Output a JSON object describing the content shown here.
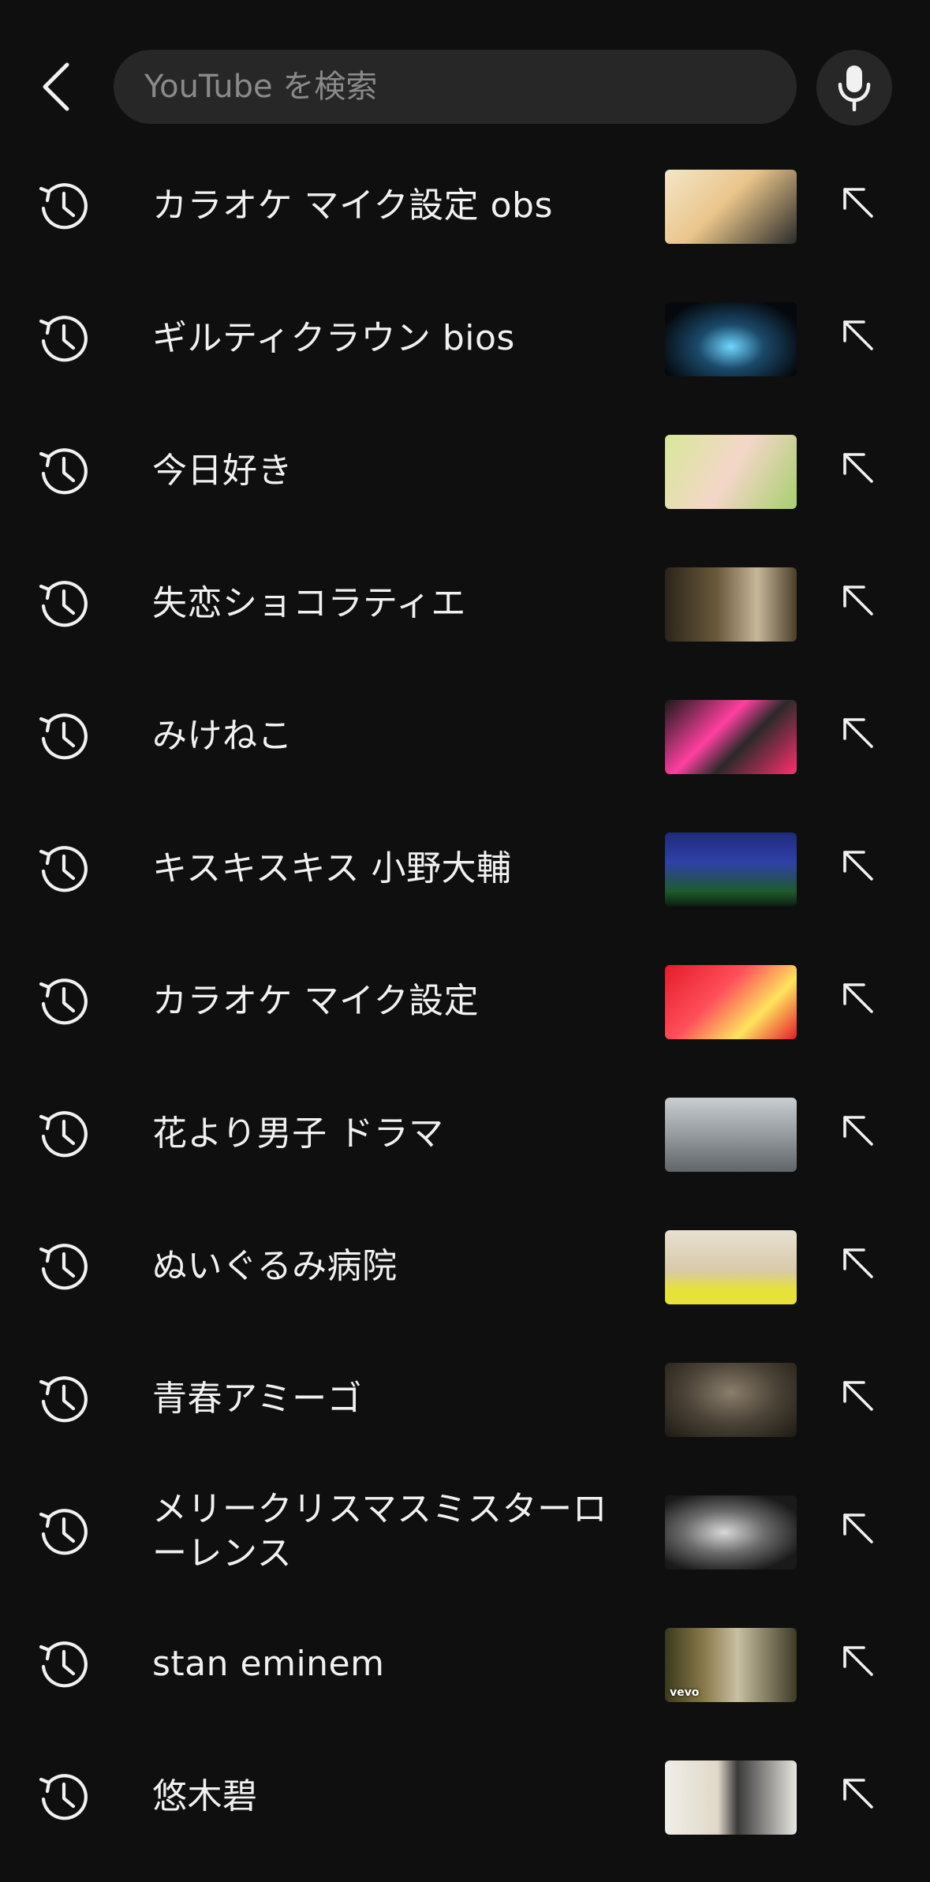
{
  "search": {
    "placeholder": "YouTube を検索"
  },
  "icons": {
    "back": "chevron-left-icon",
    "mic": "microphone-icon",
    "history": "history-clock-icon",
    "fill": "arrow-up-left-icon"
  },
  "colors": {
    "background": "#0f0f0f",
    "searchBox": "#272727",
    "text": "#f1f1f1",
    "placeholder": "#8a8a8a"
  },
  "history": [
    {
      "query": "カラオケ マイク設定 obs",
      "thumb": {
        "bg": "linear-gradient(135deg,#f4e6c8 0%,#e9c58a 45%,#2b2b2b 100%)",
        "overlay": ""
      }
    },
    {
      "query": "ギルティクラウン bios",
      "thumb": {
        "bg": "radial-gradient(ellipse at 50% 60%,#6fd6ff 0%,#1b4a6b 35%,#05080d 80%)",
        "overlay": ""
      }
    },
    {
      "query": "今日好き",
      "thumb": {
        "bg": "linear-gradient(120deg,#d7e89a 0%,#f4d6c8 50%,#a7cf6e 100%)",
        "overlay": ""
      }
    },
    {
      "query": "失恋ショコラティエ",
      "thumb": {
        "bg": "linear-gradient(90deg,#2b2418 0%,#6b5a3c 40%,#c7b79a 70%,#4a3e2a 100%)",
        "overlay": ""
      }
    },
    {
      "query": "みけねこ",
      "thumb": {
        "bg": "linear-gradient(135deg,#1a1a1a 0%,#ff3fa0 40%,#2a2a2a 60%,#ff2f6f 100%)",
        "overlay": ""
      }
    },
    {
      "query": "キスキスキス 小野大輔",
      "thumb": {
        "bg": "linear-gradient(180deg,#1e2b7a 0%,#3040a8 40%,#1d5a2c 80%,#0c1a10 100%)",
        "overlay": ""
      }
    },
    {
      "query": "カラオケ マイク設定",
      "thumb": {
        "bg": "linear-gradient(135deg,#e51b2b 0%,#ff4f5a 40%,#ffe45c 70%,#e51b2b 100%)",
        "overlay": ""
      }
    },
    {
      "query": "花より男子 ドラマ",
      "thumb": {
        "bg": "linear-gradient(180deg,#c9cdd0 0%,#9aa0a4 45%,#5f6568 100%)",
        "overlay": ""
      }
    },
    {
      "query": "ぬいぐるみ病院",
      "thumb": {
        "bg": "linear-gradient(180deg,#e8e0d2 0%,#d8c9a8 55%,#e7e23a 80%,#e7e23a 100%)",
        "overlay": ""
      }
    },
    {
      "query": "青春アミーゴ",
      "thumb": {
        "bg": "radial-gradient(ellipse at 50% 40%,#8a7e6c 0%,#4a4236 50%,#1e1a14 100%)",
        "overlay": ""
      }
    },
    {
      "query": "メリークリスマスミスターローレンス",
      "thumb": {
        "bg": "radial-gradient(ellipse at 45% 50%,#d8d8d8 0%,#6b6b6b 40%,#1a1a1a 80%)",
        "overlay": ""
      }
    },
    {
      "query": "stan eminem",
      "thumb": {
        "bg": "linear-gradient(90deg,#3b3a1e 0%,#8a7a4a 30%,#c9c0a2 55%,#3e3a26 100%)",
        "overlay": "vevo"
      }
    },
    {
      "query": "悠木碧",
      "thumb": {
        "bg": "linear-gradient(90deg,#f0eee8 0%,#e0d8c8 40%,#3a3a3a 55%,#e8e6e0 100%)",
        "overlay": ""
      }
    }
  ]
}
